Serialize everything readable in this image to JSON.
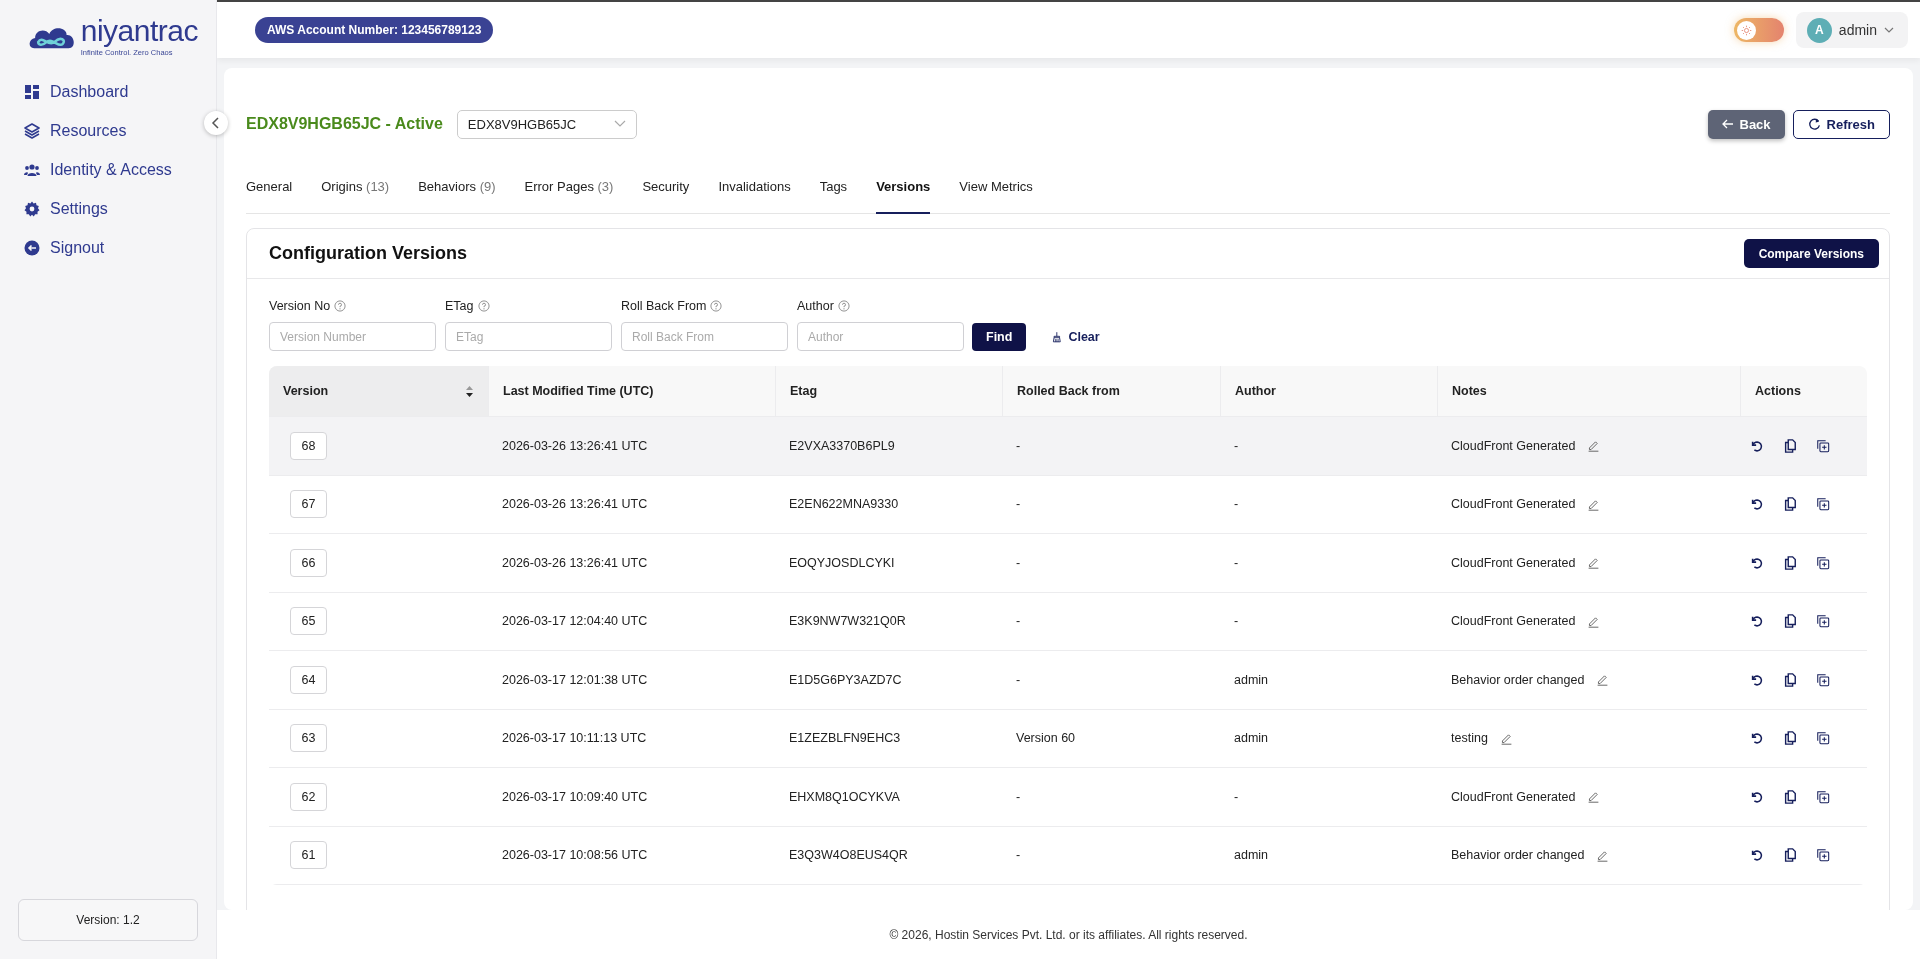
{
  "sidebar": {
    "logo": {
      "name": "niyantrac",
      "tagline": "Infinite Control. Zero Chaos"
    },
    "items": [
      {
        "label": "Dashboard",
        "selected": false
      },
      {
        "label": "Resources",
        "selected": false
      },
      {
        "label": "Identity & Access",
        "selected": false
      },
      {
        "label": "Settings",
        "selected": false
      },
      {
        "label": "Signout",
        "selected": false
      }
    ],
    "version": "Version: 1.2"
  },
  "header": {
    "account_badge": "AWS Account Number: 123456789123",
    "theme_dark": false,
    "user": {
      "avatar": "A",
      "name": "admin"
    }
  },
  "page": {
    "title": "EDX8V9HGB65JC - Active",
    "distribution_select": "EDX8V9HGB65JC",
    "back_button": "Back",
    "refresh_button": "Refresh",
    "tabs": [
      {
        "label": "General",
        "selected": false
      },
      {
        "label": "Origins",
        "count": "(13)",
        "selected": false
      },
      {
        "label": "Behaviors",
        "count": "(9)",
        "selected": false
      },
      {
        "label": "Error Pages",
        "count": "(3)",
        "selected": false
      },
      {
        "label": "Security",
        "selected": false
      },
      {
        "label": "Invalidations",
        "selected": false
      },
      {
        "label": "Tags",
        "selected": false
      },
      {
        "label": "Versions",
        "selected": true
      },
      {
        "label": "View Metrics",
        "selected": false
      }
    ]
  },
  "panel": {
    "title": "Configuration Versions",
    "compare_button": "Compare Versions",
    "filters": [
      {
        "label": "Version No",
        "placeholder": "Version Number"
      },
      {
        "label": "ETag",
        "placeholder": "ETag"
      },
      {
        "label": "Roll Back From",
        "placeholder": "Roll Back From"
      },
      {
        "label": "Author",
        "placeholder": "Author"
      }
    ],
    "find_button": "Find",
    "clear_button": "Clear",
    "table": {
      "columns": [
        {
          "label": "Version",
          "sorted": true
        },
        {
          "label": "Last Modified Time (UTC)",
          "sorted": false
        },
        {
          "label": "Etag",
          "sorted": false
        },
        {
          "label": "Rolled Back from",
          "sorted": false
        },
        {
          "label": "Author",
          "sorted": false
        },
        {
          "label": "Notes",
          "sorted": false
        },
        {
          "label": "Actions",
          "sorted": false
        }
      ],
      "rows": [
        {
          "version": "68",
          "modified": "2026-03-26 13:26:41 UTC",
          "etag": "E2VXA3370B6PL9",
          "rolled_back_from": "-",
          "author": "-",
          "notes": "CloudFront Generated",
          "highlighted": true
        },
        {
          "version": "67",
          "modified": "2026-03-26 13:26:41 UTC",
          "etag": "E2EN622MNA9330",
          "rolled_back_from": "-",
          "author": "-",
          "notes": "CloudFront Generated",
          "highlighted": false
        },
        {
          "version": "66",
          "modified": "2026-03-26 13:26:41 UTC",
          "etag": "EOQYJOSDLCYKI",
          "rolled_back_from": "-",
          "author": "-",
          "notes": "CloudFront Generated",
          "highlighted": false
        },
        {
          "version": "65",
          "modified": "2026-03-17 12:04:40 UTC",
          "etag": "E3K9NW7W321Q0R",
          "rolled_back_from": "-",
          "author": "-",
          "notes": "CloudFront Generated",
          "highlighted": false
        },
        {
          "version": "64",
          "modified": "2026-03-17 12:01:38 UTC",
          "etag": "E1D5G6PY3AZD7C",
          "rolled_back_from": "-",
          "author": "admin",
          "notes": "Behavior order changed",
          "highlighted": false
        },
        {
          "version": "63",
          "modified": "2026-03-17 10:11:13 UTC",
          "etag": "E1ZEZBLFN9EHC3",
          "rolled_back_from": "Version 60",
          "author": "admin",
          "notes": "testing",
          "highlighted": false
        },
        {
          "version": "62",
          "modified": "2026-03-17 10:09:40 UTC",
          "etag": "EHXM8Q1OCYKVA",
          "rolled_back_from": "-",
          "author": "-",
          "notes": "CloudFront Generated",
          "highlighted": false
        },
        {
          "version": "61",
          "modified": "2026-03-17 10:08:56 UTC",
          "etag": "E3Q3W4O8EUS4QR",
          "rolled_back_from": "-",
          "author": "admin",
          "notes": "Behavior order changed",
          "highlighted": false
        }
      ]
    }
  },
  "footer": "© 2026, Hostin Services Pvt. Ltd. or its affiliates. All rights reserved."
}
